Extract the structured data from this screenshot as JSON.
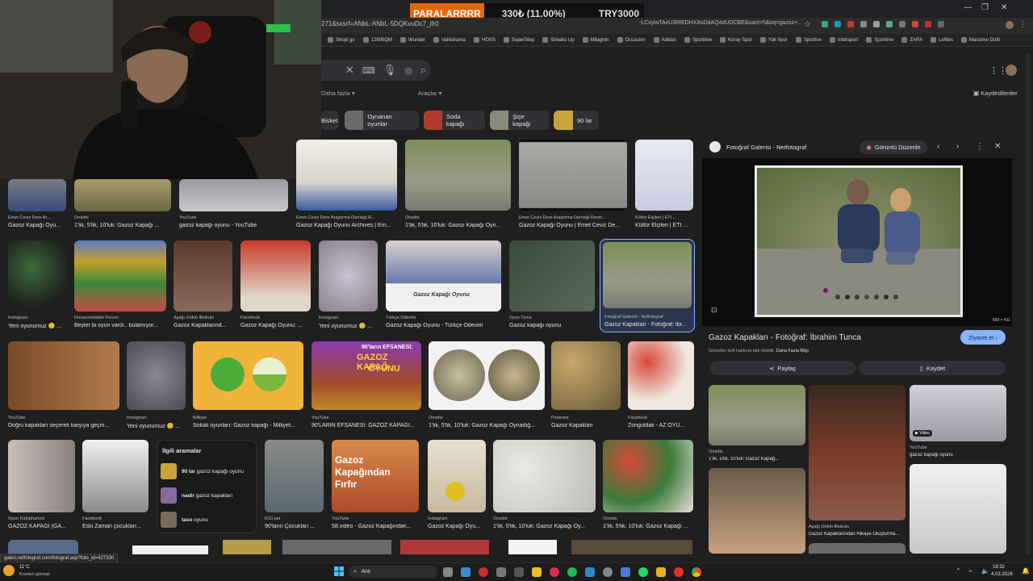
{
  "donation": {
    "name": "PARALARRRR",
    "amount": "330₺ (11.00%)",
    "goal": "TRY3000"
  },
  "browser": {
    "url_left": "271&sxsrf=ANbL-ANbL-5DQKvuDc7_jfr0",
    "url_right": "-LCxyIaTAxU3RfEDHXAsDdAQ4dUDCBE&uact=5&oq=gazoz+...",
    "bookmarks": [
      "Shopi go",
      "12905QM",
      "Wunder",
      "Vakkorama",
      "HOSS",
      "SuperStep",
      "Sneaks Up",
      "Milagron",
      "Occasion",
      "Adidas",
      "Sportime",
      "Koray Spor",
      "Yali Spor",
      "Sportive",
      "Intersport",
      "Sportime",
      "ZARA",
      "Lefties",
      "Massimo Dutti"
    ]
  },
  "search": {
    "filters": {
      "more": "Daha fazla",
      "tools": "Araçlar"
    },
    "saved": "Kaydedilenler",
    "chips": [
      {
        "label": "Bisket",
        "color": "#303134"
      },
      {
        "label": "Oynanan oyunlar",
        "color": "#6a6a6a"
      },
      {
        "label": "Soda kapağı",
        "color": "#b33a2f"
      },
      {
        "label": "Şişe kapağı",
        "color": "#8a8a7a"
      },
      {
        "label": "90 lar",
        "color": "#c9a33a"
      }
    ]
  },
  "results": {
    "row1": [
      {
        "source": "Emet Ceviz Dere Ar...",
        "title": "Gazoz Kapağı Oyu..."
      },
      {
        "source": "Onedio",
        "title": "1'lik, 5'lik, 10'luk: Gazoz Kapağı ..."
      },
      {
        "source": "YouTube",
        "title": "gazoz kapağı oyunu - YouTube"
      },
      {
        "source": "Emet Ceviz Dere Araştırma Derneği R...",
        "title": "Gazoz Kapağı Oyunu Archives | Em..."
      },
      {
        "source": "Onedio",
        "title": "1'lik, 5'lik, 10'luk: Gazoz Kapağı Oyn..."
      },
      {
        "source": "Emet Ceviz Dere Araştırma Derneği Resm...",
        "title": "Gazoz Kapağı Oyunu | Emet Ceviz De..."
      },
      {
        "source": "Kültür Elçileri | ETİ ...",
        "title": "Kültür Elçileri | ETİ ..."
      }
    ],
    "row2": [
      {
        "source": "Instagram",
        "title": "Yeni oyunumuz 😊 ..."
      },
      {
        "source": "DonanımHaber Forum",
        "title": "Beyler bi oyun vardı.. bulamıyor..."
      },
      {
        "source": "Aşağı Göklü İlkokulu",
        "title": "Gazoz Kapaklarınd..."
      },
      {
        "source": "Facebook",
        "title": "Gazoz Kapağı Oyunu: ..."
      },
      {
        "source": "Instagram",
        "title": "Yeni oyunumuz 😊 ..."
      },
      {
        "source": "Türkçe Ödevim",
        "title": "Gazoz Kapağı Oyunu - Türkçe Ödevim",
        "overlay": "Gazoz Kapağı Oyunu"
      },
      {
        "source": "Oyun Oyna",
        "title": "Gazoz kapağı oyunu"
      },
      {
        "source": "Fotoğraf Galerisi - Netfotograf",
        "title": "Gazoz Kapakları - Fotoğraf: İbr..."
      }
    ],
    "row3": [
      {
        "source": "YouTube",
        "title": "Doğru kapakları seçerek karşıya geçm..."
      },
      {
        "source": "Instagram",
        "title": "Yeni oyunumuz 😊 ..."
      },
      {
        "source": "Milliyet",
        "title": "Sokak oyunları: Gazoz kapağı - Milliyet..."
      },
      {
        "source": "YouTube",
        "title": "90'LARIN EFSANESİ: GAZOZ KAPAĞI...",
        "overlay1": "90'ların EFSANESİ:",
        "overlay2": "GAZOZ KAPAĞ",
        "overlay3": "OYUNU"
      },
      {
        "source": "Onedio",
        "title": "1'lik, 5'lik, 10'luk: Gazoz Kapağı Oynadığ..."
      },
      {
        "source": "Pinterest",
        "title": "Gazoz Kapakları"
      },
      {
        "source": "Facebook",
        "title": "Zonguldak - AZ OYU..."
      }
    ],
    "row4": [
      {
        "source": "Oyun Kütüphanesi",
        "title": "GAZOZ KAPAĞI (GA..."
      },
      {
        "source": "Facebook",
        "title": "Eski Zaman çocukları..."
      },
      {
        "source": "R10.net",
        "title": "90'ların Çocukları ..."
      },
      {
        "source": "YouTube",
        "title": "58.video - Gazoz Kapağından...",
        "overlay": "Gazoz Kapağından Fırfır"
      },
      {
        "source": "Instagram",
        "title": "Gazoz Kapağı Oyu..."
      },
      {
        "source": "Onedio",
        "title": "1'lik, 5'lik, 10'luk: Gazoz Kapağı Oy..."
      },
      {
        "source": "Onedio",
        "title": "1'lik, 5'lik, 10'luk: Gazoz Kapağı ..."
      }
    ],
    "related": {
      "heading": "İlgili aramalar",
      "items": [
        {
          "bold": "90 lar",
          "rest": " gazoz kapağı oyunu"
        },
        {
          "bold": "nadir",
          "rest": " gazoz kapakları"
        },
        {
          "bold": "taso",
          "rest": " oyunu"
        }
      ]
    }
  },
  "panel": {
    "site": "Fotoğraf Galerisi - Netfotograf",
    "lens_button": "Görüntü Düzenle",
    "size": "660 × 411",
    "title": "Gazoz Kapakları - Fotoğraf: İbrahim Tunca",
    "visit": "Ziyaret et",
    "notice": "Görseller telif hakkına tabi olabilir.",
    "notice_link": "Daha Fazla Bilgi",
    "share": "Paylaş",
    "save": "Kaydet",
    "related": [
      {
        "source": "Onedio",
        "title": "1'lik, 5'lik, 10'luk: Gazoz Kapağ..."
      },
      {
        "source": "Aşağı Göklü İlkokulu",
        "title": "Gazoz Kapaklarından Hikaye Oluşturma..."
      },
      {
        "source": "YouTube",
        "title": "gazoz kapağı oyunu",
        "badge": "Video"
      }
    ]
  },
  "status_url": "galeri.netfotograf.com/fotograf.asp?foto_id=427330",
  "taskbar": {
    "weather_temp": "11°C",
    "weather_desc": "Kısmen güneşli",
    "search": "Ara",
    "time": "18:32",
    "date": "4.03.2026"
  }
}
